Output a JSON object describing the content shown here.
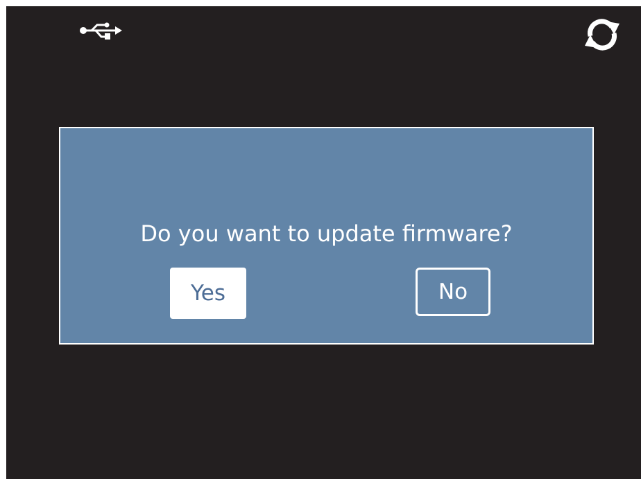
{
  "status_bar": {
    "left_icon": "usb-icon",
    "right_icon": "sync-icon"
  },
  "dialog": {
    "message": "Do you want to update firmware?",
    "yes_label": "Yes",
    "no_label": "No"
  },
  "colors": {
    "screen_background": "#231f20",
    "dialog_background": "#6285a8",
    "dialog_border": "#ffffff",
    "yes_text": "#4d6d96"
  }
}
